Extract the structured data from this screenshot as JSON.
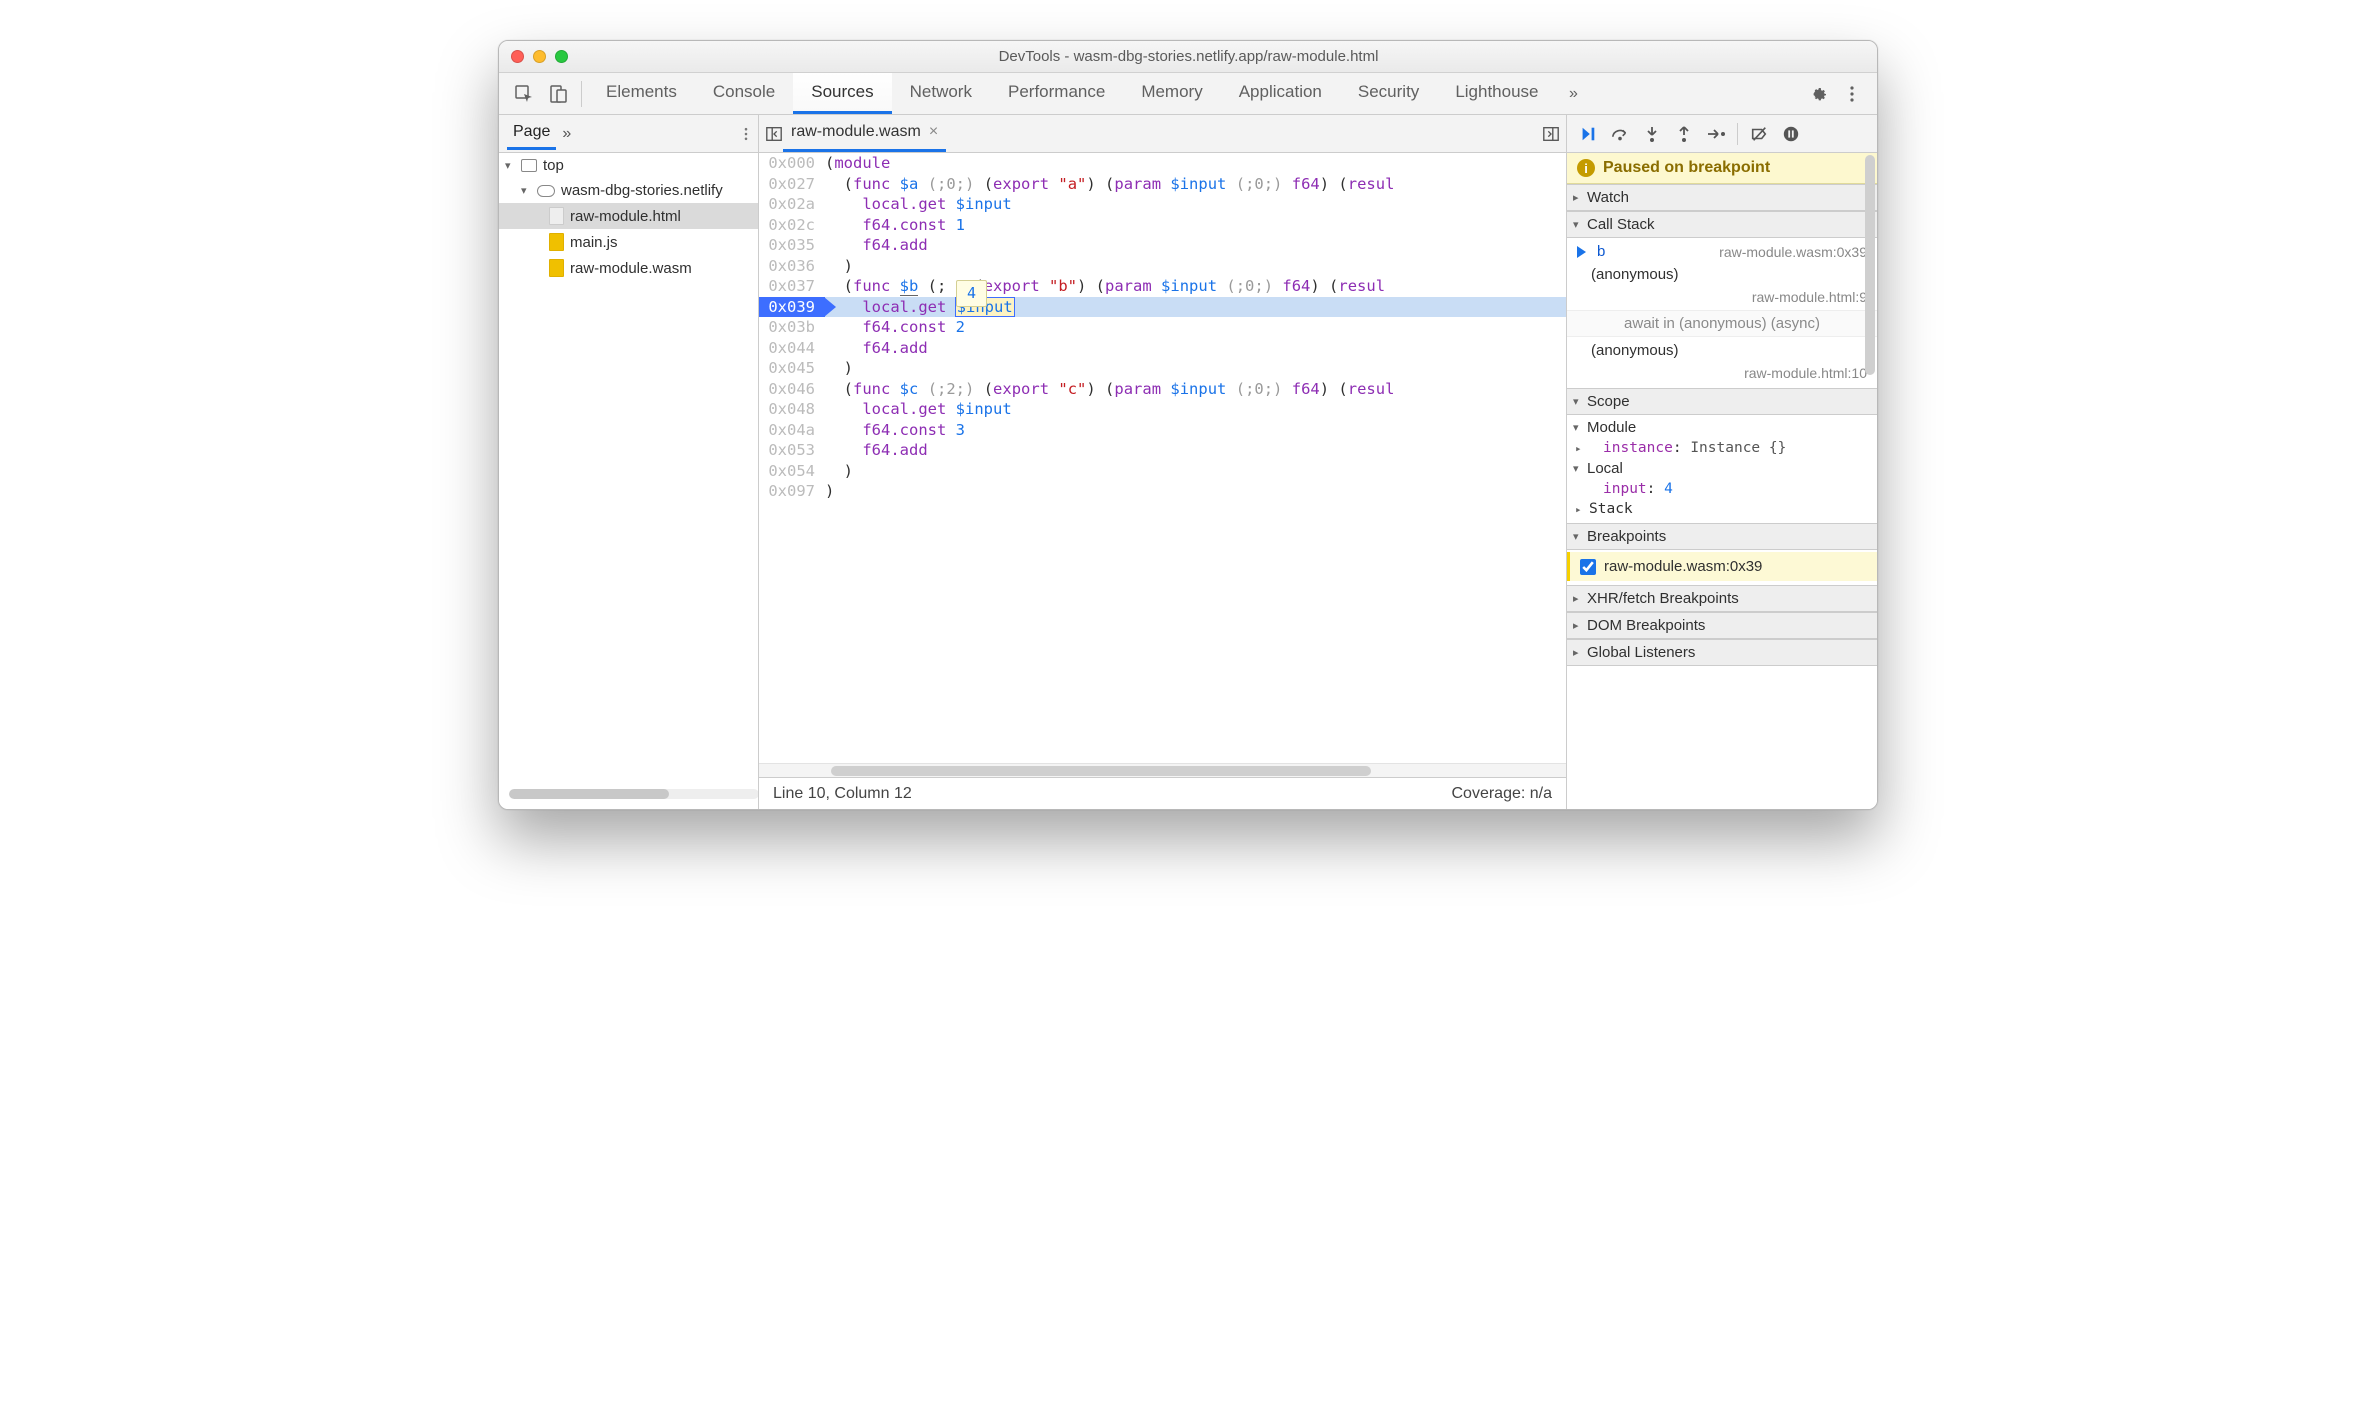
{
  "window_title": "DevTools - wasm-dbg-stories.netlify.app/raw-module.html",
  "main_tabs": [
    "Elements",
    "Console",
    "Sources",
    "Network",
    "Performance",
    "Memory",
    "Application",
    "Security",
    "Lighthouse"
  ],
  "active_main_tab": "Sources",
  "nav": {
    "tab": "Page",
    "top": "top",
    "origin": "wasm-dbg-stories.netlify",
    "files": [
      {
        "name": "raw-module.html",
        "type": "html",
        "selected": true
      },
      {
        "name": "main.js",
        "type": "js",
        "selected": false
      },
      {
        "name": "raw-module.wasm",
        "type": "js",
        "selected": false
      }
    ]
  },
  "file_tab": {
    "name": "raw-module.wasm"
  },
  "hover_value": "4",
  "code": {
    "lines": [
      {
        "addr": "0x000",
        "html": "(<span class='tok-kw'>module</span>"
      },
      {
        "addr": "0x027",
        "html": "  (<span class='tok-kw'>func</span> <span class='tok-var'>$a</span> <span class='tok-comm'>(;0;)</span> (<span class='tok-kw'>export</span> <span class='tok-str'>\"a\"</span>) (<span class='tok-kw'>param</span> <span class='tok-var'>$input</span> <span class='tok-comm'>(;0;)</span> <span class='tok-kw'>f64</span>) (<span class='tok-kw'>resul</span>"
      },
      {
        "addr": "0x02a",
        "html": "    <span class='tok-kw'>local.get</span> <span class='tok-var'>$input</span>"
      },
      {
        "addr": "0x02c",
        "html": "    <span class='tok-kw'>f64.const</span> <span class='tok-num'>1</span>"
      },
      {
        "addr": "0x035",
        "html": "    <span class='tok-kw'>f64.add</span>"
      },
      {
        "addr": "0x036",
        "html": "  )"
      },
      {
        "addr": "0x037",
        "html": "  (<span class='tok-kw'>func</span> <span class='tok-var underline'>$b</span> (;   (<span class='tok-kw'>export</span> <span class='tok-str'>\"b\"</span>) (<span class='tok-kw'>param</span> <span class='tok-var'>$input</span> <span class='tok-comm'>(;0;)</span> <span class='tok-kw'>f64</span>) (<span class='tok-kw'>resul</span>"
      },
      {
        "addr": "0x039",
        "html": "    <span class='tok-kw'>local.get</span> <span class='token-hl tok-var'>$input</span>",
        "current": true
      },
      {
        "addr": "0x03b",
        "html": "    <span class='tok-kw'>f64.const</span> <span class='tok-num'>2</span>"
      },
      {
        "addr": "0x044",
        "html": "    <span class='tok-kw'>f64.add</span>"
      },
      {
        "addr": "0x045",
        "html": "  )"
      },
      {
        "addr": "0x046",
        "html": "  (<span class='tok-kw'>func</span> <span class='tok-var'>$c</span> <span class='tok-comm'>(;2;)</span> (<span class='tok-kw'>export</span> <span class='tok-str'>\"c\"</span>) (<span class='tok-kw'>param</span> <span class='tok-var'>$input</span> <span class='tok-comm'>(;0;)</span> <span class='tok-kw'>f64</span>) (<span class='tok-kw'>resul</span>"
      },
      {
        "addr": "0x048",
        "html": "    <span class='tok-kw'>local.get</span> <span class='tok-var'>$input</span>"
      },
      {
        "addr": "0x04a",
        "html": "    <span class='tok-kw'>f64.const</span> <span class='tok-num'>3</span>"
      },
      {
        "addr": "0x053",
        "html": "    <span class='tok-kw'>f64.add</span>"
      },
      {
        "addr": "0x054",
        "html": "  )"
      },
      {
        "addr": "0x097",
        "html": ")"
      }
    ]
  },
  "status": {
    "left": "Line 10, Column 12",
    "right": "Coverage: n/a"
  },
  "debugger": {
    "paused": "Paused on breakpoint",
    "watch": "Watch",
    "callstack_label": "Call Stack",
    "frames": [
      {
        "fn": "b",
        "loc": "raw-module.wasm:0x39",
        "current": true
      },
      {
        "fn": "(anonymous)",
        "loc": "raw-module.html:9"
      }
    ],
    "async_label": "await in (anonymous) (async)",
    "async_frames": [
      {
        "fn": "(anonymous)",
        "loc": "raw-module.html:10"
      }
    ],
    "scope_label": "Scope",
    "scope": {
      "module_label": "Module",
      "module_entries": [
        {
          "k": "instance",
          "v": "Instance {}"
        }
      ],
      "local_label": "Local",
      "local_entries": [
        {
          "k": "input",
          "v": "4"
        }
      ],
      "stack_label": "Stack"
    },
    "breakpoints_label": "Breakpoints",
    "breakpoints": [
      {
        "label": "raw-module.wasm:0x39",
        "checked": true
      }
    ],
    "xhr_label": "XHR/fetch Breakpoints",
    "dom_label": "DOM Breakpoints",
    "global_label": "Global Listeners"
  }
}
